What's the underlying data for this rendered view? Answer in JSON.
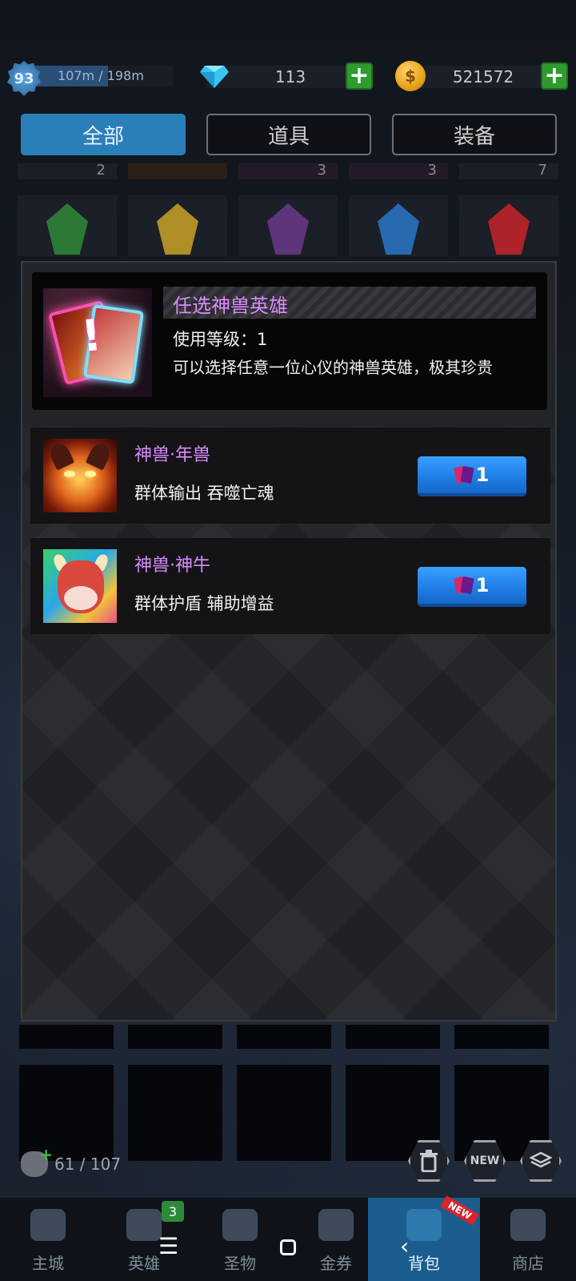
{
  "player": {
    "level": "93",
    "exp_text": "107m / 198m",
    "exp_fraction": 0.54
  },
  "currency": {
    "gems": "113",
    "coins": "521572"
  },
  "tabs": [
    {
      "label": "全部",
      "active": true
    },
    {
      "label": "道具",
      "active": false
    },
    {
      "label": "装备",
      "active": false
    }
  ],
  "inventory_partial": {
    "counts": [
      "2",
      "",
      "3",
      "3",
      "7"
    ],
    "gem_colors": [
      "#2f8a3a",
      "#c9a227",
      "#6a3a8a",
      "#2a78c8",
      "#c8242a"
    ]
  },
  "item_detail": {
    "title": "任选神兽英雄",
    "level_text": "使用等级：1",
    "description": "可以选择任意一位心仪的神兽英雄，极其珍贵"
  },
  "heroes": [
    {
      "name": "神兽·年兽",
      "skills": "群体输出 吞噬亡魂",
      "cost": "1"
    },
    {
      "name": "神兽·神牛",
      "skills": "群体护盾 辅助增益",
      "cost": "1"
    }
  ],
  "bag": {
    "capacity_text": "61 / 107"
  },
  "action_buttons": {
    "new_label": "NEW"
  },
  "bottom_nav": [
    {
      "label": "主城",
      "icon": "castle-icon",
      "active": false,
      "badge": ""
    },
    {
      "label": "英雄",
      "icon": "helmet-icon",
      "active": false,
      "badge": "3"
    },
    {
      "label": "圣物",
      "icon": "clover-icon",
      "active": false,
      "badge": ""
    },
    {
      "label": "金券",
      "icon": "ticket-icon",
      "active": false,
      "badge": ""
    },
    {
      "label": "背包",
      "icon": "backpack-icon",
      "active": true,
      "badge": "",
      "ribbon": "NEW"
    },
    {
      "label": "商店",
      "icon": "cart-icon",
      "active": false,
      "badge": ""
    }
  ],
  "system_nav": {
    "menu": "☰",
    "back": "‹"
  },
  "colors": {
    "accent_blue": "#2a7fb8",
    "hero_name_purple": "#d98bff",
    "plus_green": "#2f9b2f"
  }
}
